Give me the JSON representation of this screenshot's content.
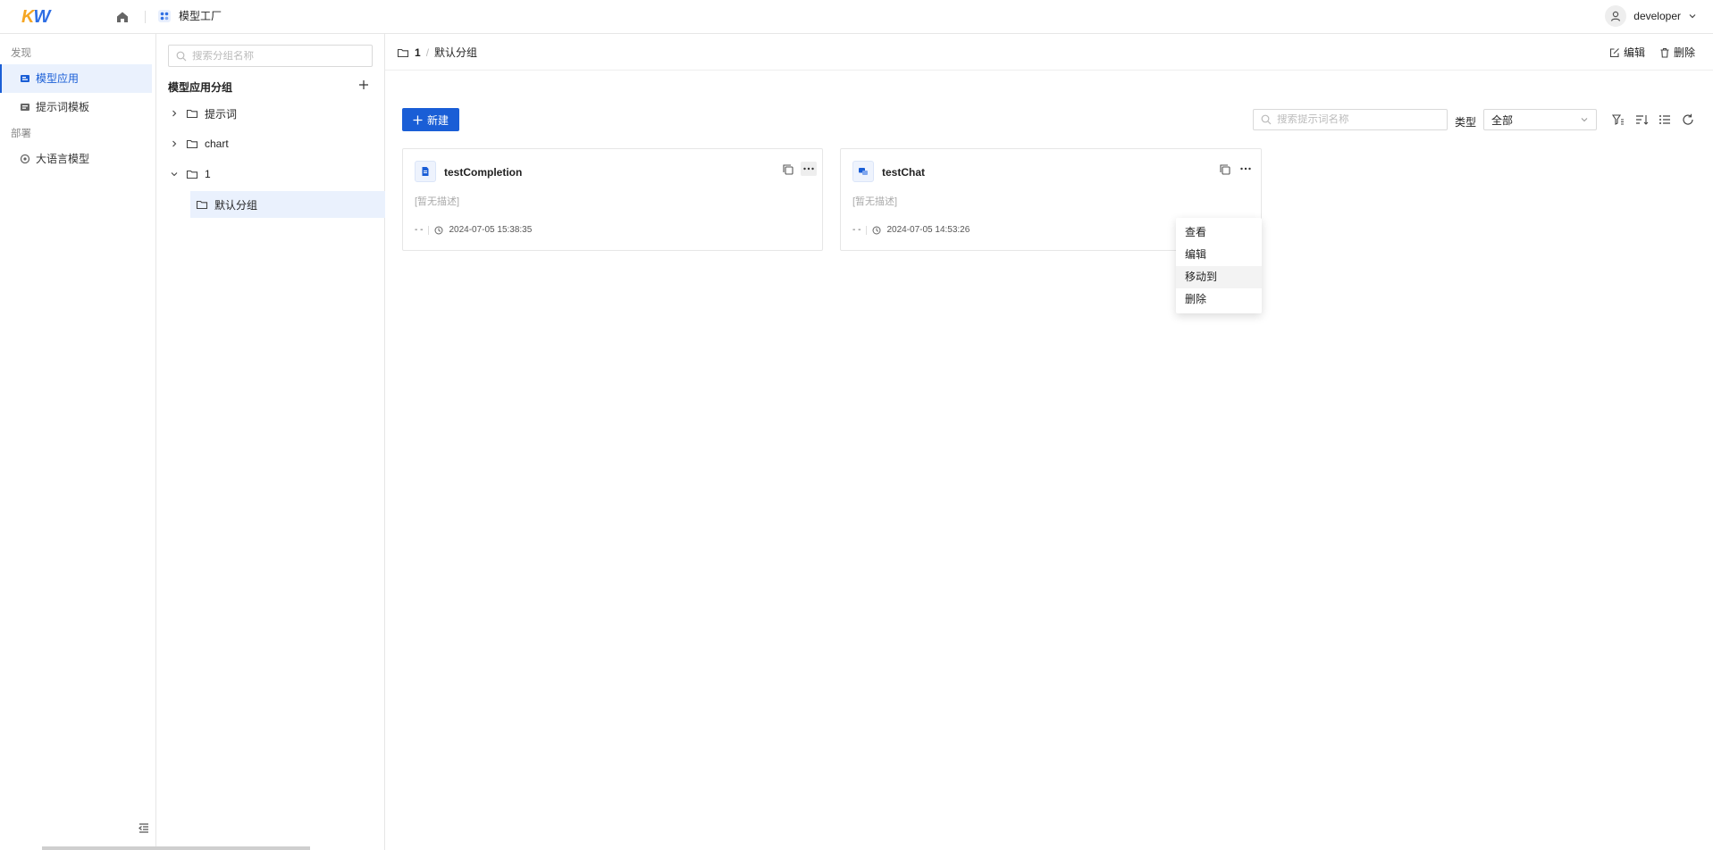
{
  "app": {
    "module_name": "模型工厂",
    "user_name": "developer"
  },
  "colors": {
    "accent": "#1a5ed6",
    "logo_orange": "#f5a623",
    "logo_blue": "#2f6fe4"
  },
  "leftnav": {
    "groups": [
      {
        "label": "发现",
        "items": [
          {
            "label": "模型应用",
            "icon": "app-icon",
            "active": true
          },
          {
            "label": "提示词模板",
            "icon": "template-icon"
          }
        ]
      },
      {
        "label": "部署",
        "items": [
          {
            "label": "大语言模型",
            "icon": "model-icon"
          }
        ]
      }
    ]
  },
  "group_panel": {
    "search_placeholder": "搜索分组名称",
    "title": "模型应用分组",
    "tree": [
      {
        "label": "提示词",
        "expanded": false
      },
      {
        "label": "chart",
        "expanded": false
      },
      {
        "label": "1",
        "expanded": true,
        "children": [
          {
            "label": "默认分组",
            "selected": true
          }
        ]
      }
    ]
  },
  "main": {
    "breadcrumb": [
      "1",
      "默认分组"
    ],
    "actions": {
      "edit": "编辑",
      "delete": "删除"
    },
    "new_button": "新建",
    "search_placeholder": "搜索提示词名称",
    "type_label": "类型",
    "type_value": "全部",
    "cards": [
      {
        "name": "testCompletion",
        "type_icon": "document-icon",
        "description": "[暂无描述]",
        "author": "- -",
        "time": "2024-07-05 15:38:35"
      },
      {
        "name": "testChat",
        "type_icon": "chat-icon",
        "description": "[暂无描述]",
        "author": "- -",
        "time": "2024-07-05 14:53:26"
      }
    ],
    "dropdown": [
      "查看",
      "编辑",
      "移动到",
      "删除"
    ]
  }
}
